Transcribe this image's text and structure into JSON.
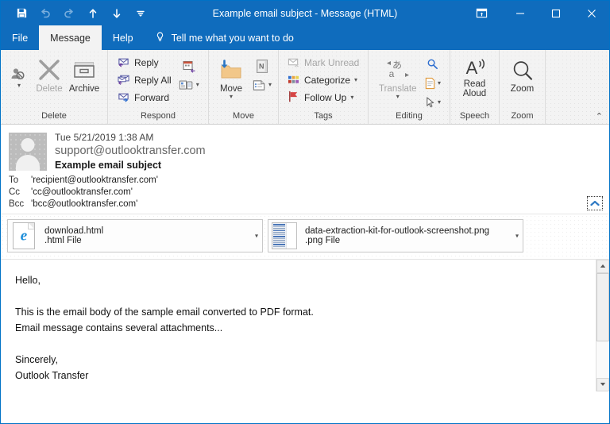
{
  "window": {
    "title": "Example email subject  -  Message (HTML)",
    "quick_access": [
      {
        "name": "save-icon",
        "label": "Save",
        "enabled": true
      },
      {
        "name": "undo-icon",
        "label": "Undo",
        "enabled": false
      },
      {
        "name": "redo-icon",
        "label": "Redo",
        "enabled": false
      },
      {
        "name": "previous-item-icon",
        "label": "Previous Item",
        "enabled": true
      },
      {
        "name": "next-item-icon",
        "label": "Next Item",
        "enabled": true
      },
      {
        "name": "customize-qat-icon",
        "label": "Customize Quick Access Toolbar",
        "enabled": true
      }
    ],
    "controls": [
      {
        "name": "ribbon-display-options",
        "label": "Ribbon Display Options"
      },
      {
        "name": "minimize-button",
        "label": "Minimize"
      },
      {
        "name": "maximize-button",
        "label": "Maximize"
      },
      {
        "name": "close-button",
        "label": "Close"
      }
    ]
  },
  "tabs": [
    {
      "label": "File",
      "active": false
    },
    {
      "label": "Message",
      "active": true
    },
    {
      "label": "Help",
      "active": false
    }
  ],
  "tell_me": {
    "icon": "lightbulb-icon",
    "label": "Tell me what you want to do"
  },
  "ribbon": {
    "collapse_label": "⌃",
    "groups": [
      {
        "name": "delete",
        "label": "Delete",
        "buttons": [
          {
            "label": "Delete",
            "icon": "delete-x-icon",
            "disabled": true
          },
          {
            "label": "Archive",
            "icon": "archive-box-icon",
            "disabled": false
          },
          {
            "label": "Junk",
            "icon": "junk-person-icon",
            "disabled": false
          }
        ]
      },
      {
        "name": "respond",
        "label": "Respond",
        "items": [
          {
            "label": "Reply",
            "icon": "reply-icon"
          },
          {
            "label": "Reply All",
            "icon": "reply-all-icon"
          },
          {
            "label": "Forward",
            "icon": "forward-icon"
          },
          {
            "label": "Meeting",
            "icon": "meeting-icon"
          },
          {
            "label": "More Respond Actions",
            "icon": "more-respond-icon"
          }
        ]
      },
      {
        "name": "move",
        "label": "Move",
        "buttons": [
          {
            "label": "Move",
            "icon": "move-folder-icon"
          },
          {
            "label": "OneNote",
            "icon": "onenote-icon"
          },
          {
            "label": "Rules",
            "icon": "rules-icon"
          }
        ]
      },
      {
        "name": "tags",
        "label": "Tags",
        "launcher": "⬌",
        "items": [
          {
            "label": "Mark Unread",
            "icon": "mark-unread-icon",
            "disabled": true
          },
          {
            "label": "Categorize",
            "icon": "categorize-icon",
            "disabled": false,
            "dropdown": true
          },
          {
            "label": "Follow Up",
            "icon": "follow-up-flag-icon",
            "disabled": false,
            "dropdown": true
          }
        ]
      },
      {
        "name": "editing",
        "label": "Editing",
        "buttons": [
          {
            "label": "Translate",
            "icon": "translate-icon",
            "disabled": true
          },
          {
            "label": "Find",
            "icon": "find-magnifier-icon"
          },
          {
            "label": "Related",
            "icon": "related-document-icon"
          },
          {
            "label": "Select",
            "icon": "select-cursor-icon"
          }
        ]
      },
      {
        "name": "speech",
        "label": "Speech",
        "buttons": [
          {
            "label": "Read Aloud",
            "icon": "read-aloud-icon"
          }
        ]
      },
      {
        "name": "zoom",
        "label": "Zoom",
        "buttons": [
          {
            "label": "Zoom",
            "icon": "zoom-magnifier-icon"
          }
        ]
      }
    ]
  },
  "message": {
    "avatar_icon": "contact-avatar-icon",
    "date": "Tue 5/21/2019 1:38 AM",
    "from": "support@outlooktransfer.com",
    "subject": "Example email subject",
    "recipients": [
      {
        "label": "To",
        "value": "'recipient@outlooktransfer.com'"
      },
      {
        "label": "Cc",
        "value": "'cc@outlooktransfer.com'"
      },
      {
        "label": "Bcc",
        "value": "'bcc@outlooktransfer.com'"
      }
    ],
    "collapse_header_icon": "chevron-up-icon"
  },
  "attachments": [
    {
      "name": "download.html",
      "type": "(.html File)",
      "type_label": ".html File",
      "icon": "ie-html-file-icon",
      "dropdown": "▾"
    },
    {
      "name": "data-extraction-kit-for-outlook-screenshot.png",
      "type_label": ".png File",
      "icon": "png-image-thumbnail-icon",
      "dropdown": "▾"
    }
  ],
  "body": {
    "lines": [
      "Hello,",
      "",
      "This is the email body of the sample email converted to PDF format.",
      "Email message contains several attachments...",
      "",
      "Sincerely,",
      "Outlook Transfer"
    ]
  },
  "scrollbar": {
    "up_label": "▲",
    "down_label": "▼"
  },
  "colors": {
    "titlebar": "#0f6cbd",
    "ribbon_bg": "#f3f3f3",
    "accent": "#0072c6",
    "body_bg": "#ffffff"
  }
}
